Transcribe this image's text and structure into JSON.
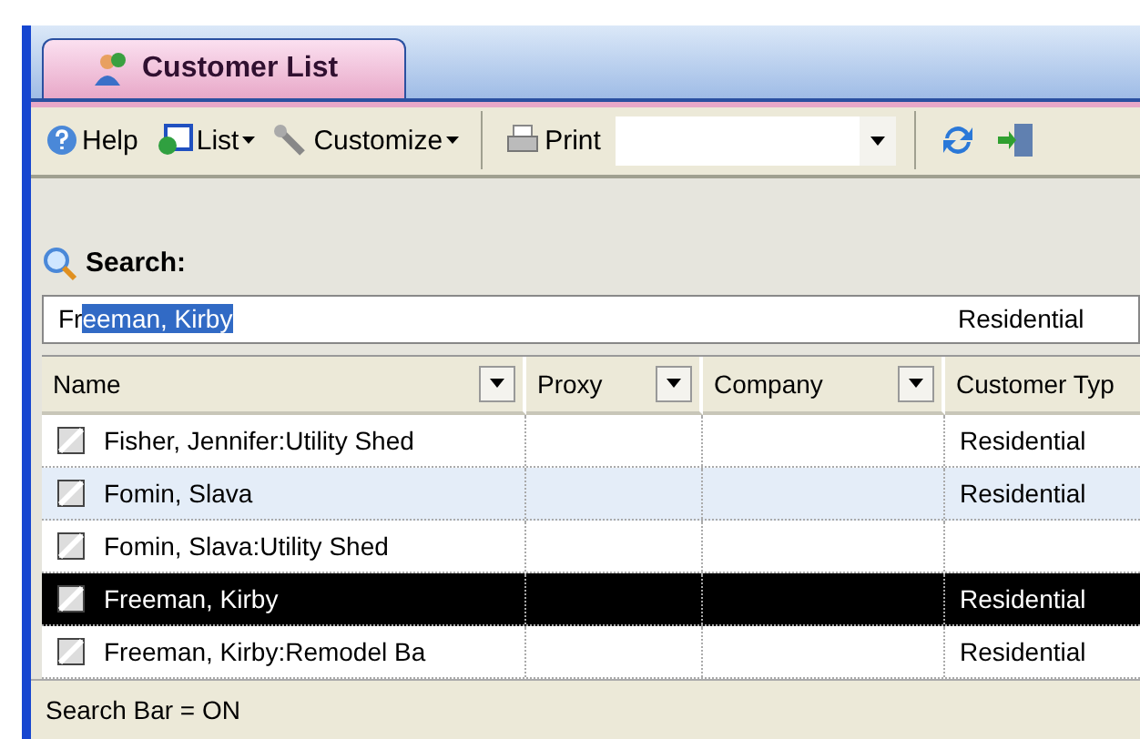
{
  "tabs": [
    {
      "label": "Customer List",
      "selected": true
    }
  ],
  "toolbar": [
    {
      "kind": "button",
      "label": "Help"
    },
    {
      "kind": "menu",
      "label": "List"
    },
    {
      "kind": "menu",
      "label": "Customize"
    },
    {
      "kind": "separator"
    },
    {
      "kind": "button",
      "label": "Print"
    },
    {
      "kind": "combo"
    },
    {
      "kind": "separator"
    },
    {
      "kind": "icon"
    },
    {
      "kind": "icon"
    }
  ],
  "search": {
    "label": "Search:",
    "typed": "Fr",
    "highlighted": "eeman, Kirby",
    "hint": "Residential"
  },
  "table": {
    "columns": [
      {
        "label": "Name",
        "filter": true
      },
      {
        "label": "Proxy",
        "filter": true
      },
      {
        "label": "Company",
        "filter": true
      },
      {
        "label": "Customer Typ",
        "filter": false
      }
    ],
    "rows": [
      {
        "cells": [
          "Fisher, Jennifer:Utility Shed",
          "",
          "",
          "Residential"
        ],
        "selected": false,
        "alt": false
      },
      {
        "cells": [
          "Fomin, Slava",
          "",
          "",
          "Residential"
        ],
        "selected": false,
        "alt": true
      },
      {
        "cells": [
          "Fomin, Slava:Utility Shed",
          "",
          "",
          ""
        ],
        "selected": false,
        "alt": false
      },
      {
        "cells": [
          "Freeman, Kirby",
          "",
          "",
          "Residential"
        ],
        "selected": true,
        "alt": false
      },
      {
        "cells": [
          "Freeman, Kirby:Remodel Ba",
          "",
          "",
          "Residential"
        ],
        "selected": false,
        "alt": false
      }
    ]
  },
  "status_bar": "Search Bar = ON"
}
